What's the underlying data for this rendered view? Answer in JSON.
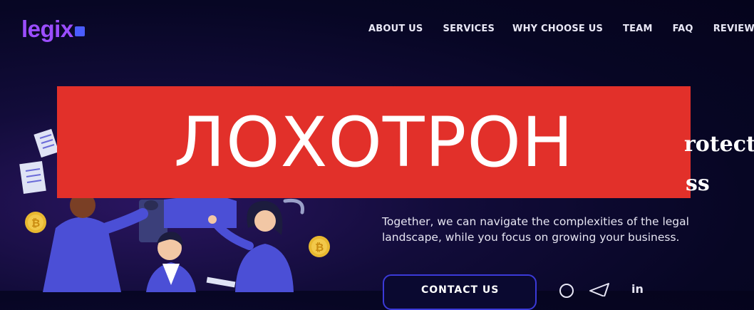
{
  "brand": {
    "logo_text": "legix"
  },
  "nav": {
    "items": [
      "ABOUT US",
      "SERVICES",
      "WHY CHOOSE US",
      "TEAM",
      "FAQ",
      "REVIEWS"
    ]
  },
  "overlay": {
    "stamp_text": "ЛОХОТРОН"
  },
  "hero": {
    "headline_fragment_1": "rotect",
    "headline_fragment_2": "ss",
    "subtitle_line1": "Together, we can navigate the complexities of the legal",
    "subtitle_line2": "landscape, while you focus on growing your business.",
    "cta_label": "CONTACT US"
  },
  "social": {
    "icons": [
      "whatsapp-icon",
      "telegram-icon",
      "linkedin-icon"
    ],
    "linkedin_label": "in"
  },
  "colors": {
    "background": "#070624",
    "accent_purple": "#9b4dff",
    "banner_red": "#e2302a",
    "cta_border": "#3b3ad8",
    "coin_gold": "#e8b830"
  }
}
